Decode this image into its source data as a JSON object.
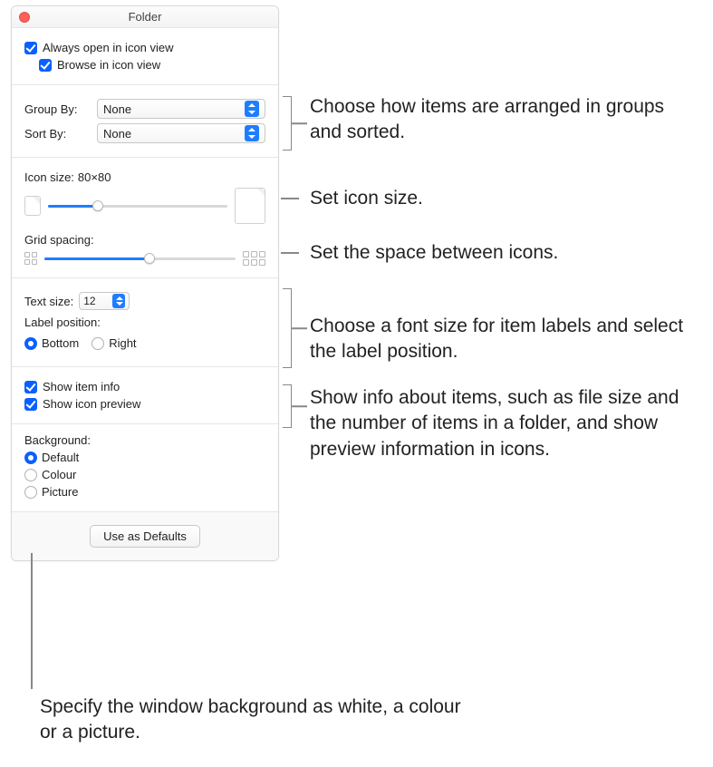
{
  "window": {
    "title": "Folder"
  },
  "view_options": {
    "always_open_label": "Always open in icon view",
    "always_open_checked": true,
    "browse_label": "Browse in icon view",
    "browse_checked": true
  },
  "sorting": {
    "group_by_label": "Group By:",
    "group_by_value": "None",
    "sort_by_label": "Sort By:",
    "sort_by_value": "None"
  },
  "icon_size": {
    "label": "Icon size:",
    "value": "80×80",
    "slider_percent": 28
  },
  "grid_spacing": {
    "label": "Grid spacing:",
    "slider_percent": 55
  },
  "text": {
    "size_label": "Text size:",
    "size_value": "12",
    "position_label": "Label position:",
    "bottom_label": "Bottom",
    "right_label": "Right",
    "position_selected": "bottom"
  },
  "show": {
    "item_info_label": "Show item info",
    "item_info_checked": true,
    "icon_preview_label": "Show icon preview",
    "icon_preview_checked": true
  },
  "background": {
    "heading": "Background:",
    "default_label": "Default",
    "colour_label": "Colour",
    "picture_label": "Picture",
    "selected": "default"
  },
  "footer": {
    "use_defaults": "Use as Defaults"
  },
  "callouts": {
    "sort": "Choose how items are arranged in groups and sorted.",
    "icon_size": "Set icon size.",
    "grid": "Set the space between icons.",
    "text": "Choose a font size for item labels and select the label position.",
    "show": "Show info about items, such as file size and the number of items in a folder, and show preview information in icons.",
    "background": "Specify the window background as white, a colour or a picture."
  }
}
